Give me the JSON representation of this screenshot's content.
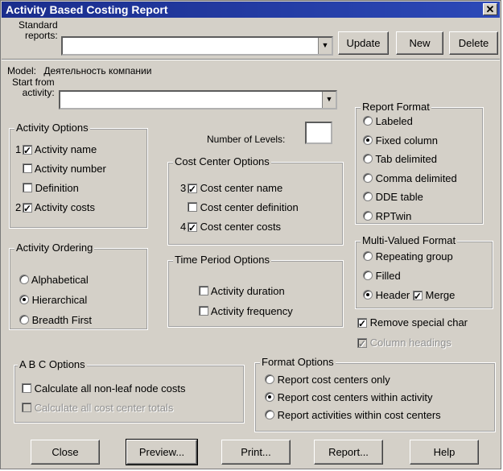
{
  "window": {
    "title": "Activity Based Costing Report",
    "close_glyph": "✕"
  },
  "standard_reports": {
    "label_line1": "Standard",
    "label_line2": "reports:",
    "value": ""
  },
  "buttons": {
    "update": "Update",
    "new": "New",
    "delete": "Delete",
    "close": "Close",
    "preview": "Preview...",
    "print": "Print...",
    "report": "Report...",
    "help": "Help"
  },
  "model": {
    "label": "Model:",
    "value": "Деятельность компании"
  },
  "start_from": {
    "label_line1": "Start from",
    "label_line2": "activity:",
    "value": ""
  },
  "number_of_levels": {
    "label": "Number of Levels:",
    "value": ""
  },
  "activity_options": {
    "title": "Activity Options",
    "items": [
      {
        "prefix": "1",
        "label": "Activity name",
        "checked": true
      },
      {
        "prefix": "",
        "label": "Activity number",
        "checked": false
      },
      {
        "prefix": "",
        "label": "Definition",
        "checked": false
      },
      {
        "prefix": "2",
        "label": "Activity costs",
        "checked": true
      }
    ]
  },
  "cost_center_options": {
    "title": "Cost Center Options",
    "items": [
      {
        "prefix": "3",
        "label": "Cost center name",
        "checked": true
      },
      {
        "prefix": "",
        "label": "Cost center definition",
        "checked": false
      },
      {
        "prefix": "4",
        "label": "Cost center costs",
        "checked": true
      }
    ]
  },
  "report_format": {
    "title": "Report Format",
    "options": [
      "Labeled",
      "Fixed column",
      "Tab delimited",
      "Comma delimited",
      "DDE table",
      "RPTwin"
    ],
    "selected": "Fixed column"
  },
  "multi_valued_format": {
    "title": "Multi-Valued Format",
    "options": [
      "Repeating group",
      "Filled",
      "Header"
    ],
    "selected": "Header",
    "merge_label": "Merge",
    "merge_checked": true
  },
  "remove_special_char": {
    "label": "Remove special char",
    "checked": true
  },
  "column_headings": {
    "label": "Column headings",
    "checked": true,
    "disabled": true
  },
  "activity_ordering": {
    "title": "Activity Ordering",
    "options": [
      "Alphabetical",
      "Hierarchical",
      "Breadth First"
    ],
    "selected": "Hierarchical"
  },
  "time_period_options": {
    "title": "Time Period Options",
    "items": [
      {
        "label": "Activity duration",
        "checked": false
      },
      {
        "label": "Activity frequency",
        "checked": false
      }
    ]
  },
  "abc_options": {
    "title": "A B C  Options",
    "items": [
      {
        "label": "Calculate all non-leaf node costs",
        "checked": false,
        "disabled": false
      },
      {
        "label": "Calculate all cost center totals",
        "checked": false,
        "disabled": true
      }
    ]
  },
  "format_options": {
    "title": "Format Options",
    "options": [
      "Report cost centers only",
      "Report cost centers within activity",
      "Report activities within cost centers"
    ],
    "selected": "Report cost centers within activity"
  },
  "colors": {
    "title_bar": "#1a2d8c",
    "face": "#d4d0c8"
  }
}
